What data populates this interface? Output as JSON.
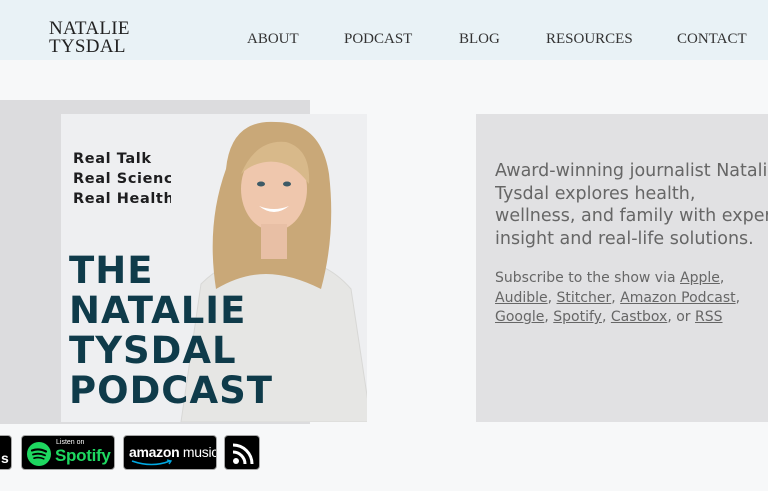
{
  "header": {
    "logo_line1": "NATALIE",
    "logo_line2": "TYSDAL",
    "nav": [
      "ABOUT",
      "PODCAST",
      "BLOG",
      "RESOURCES",
      "CONTACT"
    ]
  },
  "cover": {
    "tagline": [
      "Real Talk",
      "Real Science",
      "Real Health"
    ],
    "title": [
      "THE",
      "NATALIE",
      "TYSDAL",
      "PODCAST"
    ]
  },
  "description": {
    "lines": [
      "Award-winning journalist Natalie",
      "Tysdal explores health,",
      "wellness, and family with expert",
      "insight and real-life solutions."
    ]
  },
  "subscribe": {
    "prefix": "Subscribe to the show via ",
    "links": [
      "Apple",
      "Audible",
      "Stitcher",
      "Amazon Podcast",
      "Google",
      "Spotify",
      "Castbox"
    ],
    "sep": ", ",
    "or": ", or ",
    "last": "RSS"
  },
  "badges": {
    "apple_partial": "s",
    "spotify_top": "Listen on",
    "spotify_name": "Spotify",
    "amazon_name": "amazon",
    "amazon_music": "music"
  },
  "colors": {
    "header_bg": "#e9f2f6",
    "cover_title": "#0f3b4a",
    "spotify_green": "#1ed760",
    "panel_gray": "#e1e1e3"
  },
  "icons": [
    "spotify-icon",
    "amazon-smile-icon",
    "rss-icon"
  ]
}
